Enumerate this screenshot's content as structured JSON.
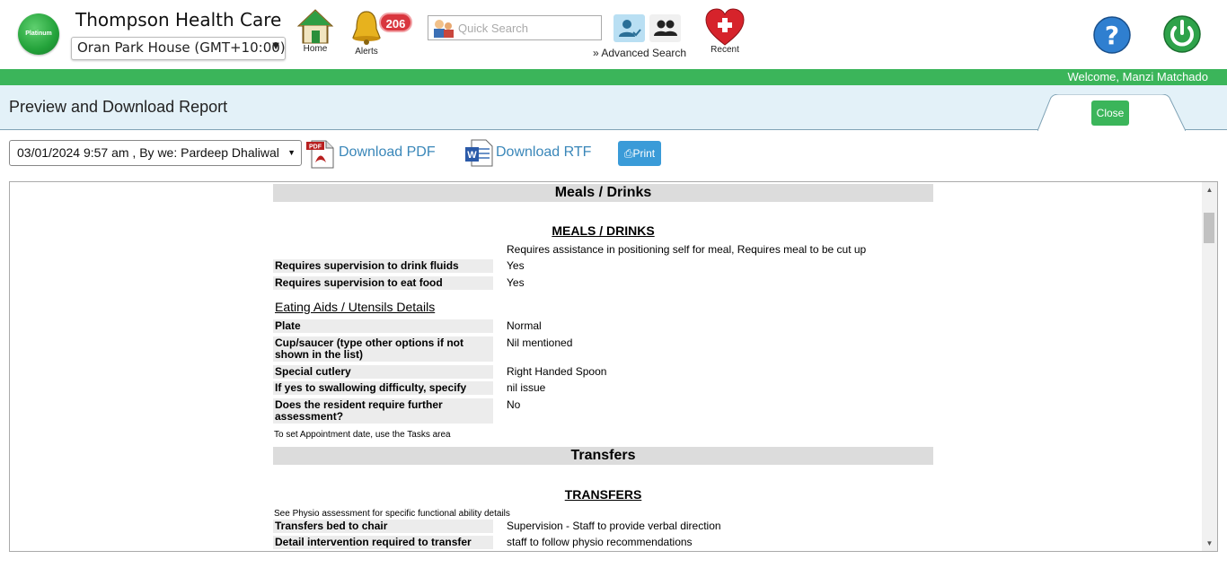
{
  "header": {
    "logo_text": "Platinum",
    "org_name": "Thompson Health Care",
    "facility": "Oran Park House (GMT+10:00)",
    "nav": {
      "home_label": "Home",
      "alerts_label": "Alerts",
      "alerts_count": "206",
      "recent_label": "Recent"
    },
    "search": {
      "placeholder": "Quick Search",
      "advanced_label": "» Advanced Search"
    }
  },
  "welcome": "Welcome, Manzi Matchado",
  "page": {
    "title": "Preview and Download Report",
    "close_label": "Close"
  },
  "toolbar": {
    "version": "03/01/2024 9:57 am , By we: Pardeep Dhaliwal",
    "download_pdf": "Download PDF",
    "download_rtf": "Download RTF",
    "print": "Print",
    "pdf_badge": "PDF"
  },
  "report": {
    "meals": {
      "header": "Meals / Drinks",
      "subtitle": "MEALS / DRINKS",
      "intro_value": "Requires assistance in positioning self for meal, Requires meal to be cut up",
      "rows": [
        {
          "label": "Requires supervision to drink fluids",
          "value": "Yes"
        },
        {
          "label": "Requires supervision to eat food",
          "value": "Yes"
        }
      ],
      "aids_heading": "Eating Aids / Utensils Details",
      "aids_rows": [
        {
          "label": "Plate",
          "value": "Normal"
        },
        {
          "label": "Cup/saucer (type other options if not shown in the list)",
          "value": "Nil mentioned"
        },
        {
          "label": "Special cutlery",
          "value": "Right Handed Spoon"
        },
        {
          "label": "If yes to swallowing difficulty, specify",
          "value": "nil issue"
        },
        {
          "label": "Does the resident require further assessment?",
          "value": "No"
        }
      ],
      "note": "To set Appointment date, use the Tasks area"
    },
    "transfers": {
      "header": "Transfers",
      "subtitle": "TRANSFERS",
      "note": "See Physio assessment for specific functional ability details",
      "rows": [
        {
          "label": "Transfers bed to chair",
          "value": "Supervision - Staff to provide verbal direction"
        },
        {
          "label": "Detail intervention required to transfer",
          "value": "staff to follow physio recommendations"
        }
      ]
    }
  },
  "colors": {
    "brand_green": "#3bb55a",
    "link_blue": "#3a87b9",
    "alert_red": "#d9363e"
  }
}
